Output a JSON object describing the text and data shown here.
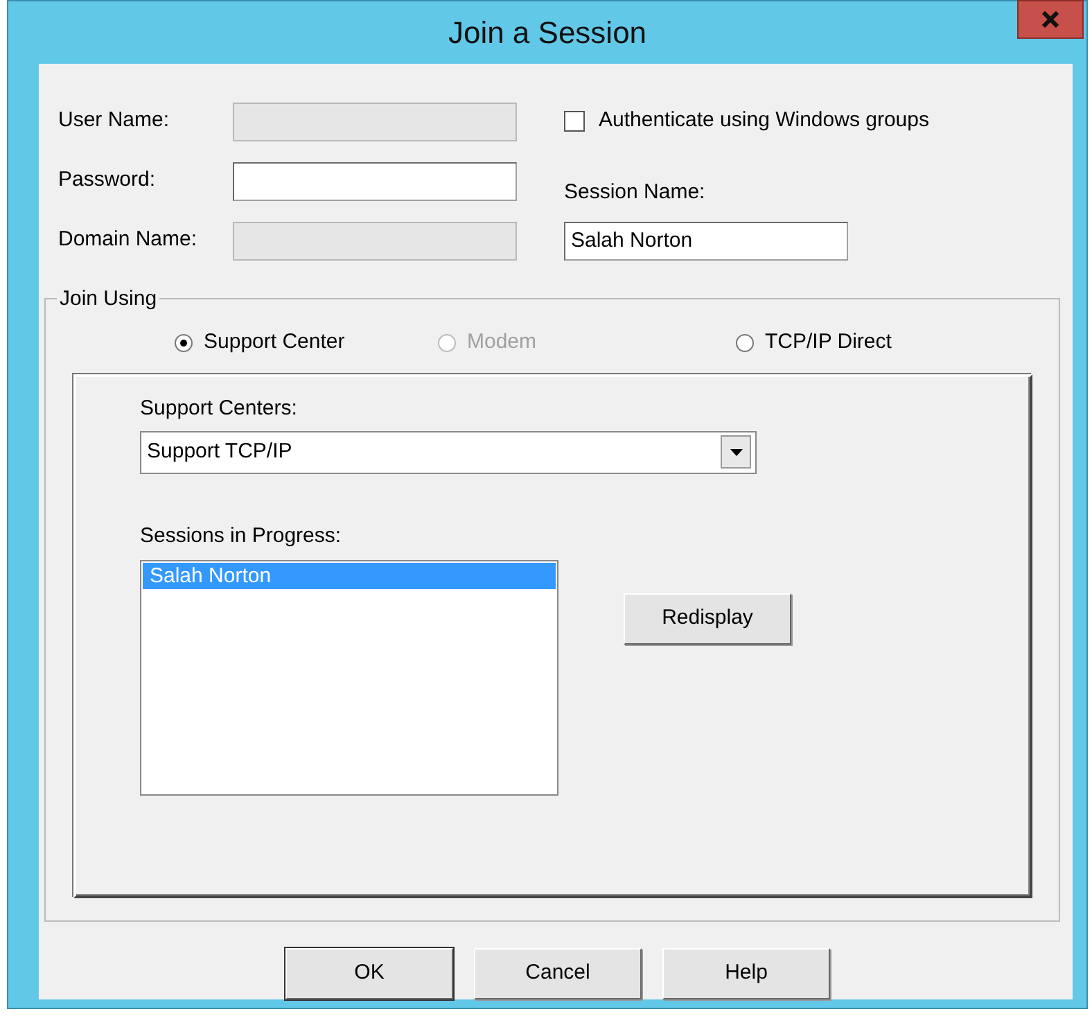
{
  "window": {
    "title": "Join a Session"
  },
  "fields": [
    {
      "label": "User Name:",
      "disabled": true
    },
    {
      "label": "Password:",
      "disabled": false
    },
    {
      "label": "Domain Name:",
      "disabled": true
    }
  ],
  "authenticate": {
    "label": "Authenticate using Windows groups",
    "checked": false
  },
  "session_name": {
    "label": "Session Name:",
    "value": "Salah Norton"
  },
  "join_using": {
    "legend": "Join Using",
    "options": [
      {
        "label": "Support Center",
        "selected": true,
        "disabled": false
      },
      {
        "label": "Modem",
        "selected": false,
        "disabled": true
      },
      {
        "label": "TCP/IP Direct",
        "selected": false,
        "disabled": false
      }
    ],
    "support_centers": {
      "label": "Support Centers:",
      "value": "Support TCP/IP"
    },
    "sessions": {
      "label": "Sessions in Progress:",
      "items": [
        {
          "text": "Salah Norton",
          "selected": true
        }
      ]
    },
    "redisplay": "Redisplay"
  },
  "buttons": [
    {
      "label": "OK",
      "default": true
    },
    {
      "label": "Cancel",
      "default": false
    },
    {
      "label": "Help",
      "default": false
    }
  ]
}
